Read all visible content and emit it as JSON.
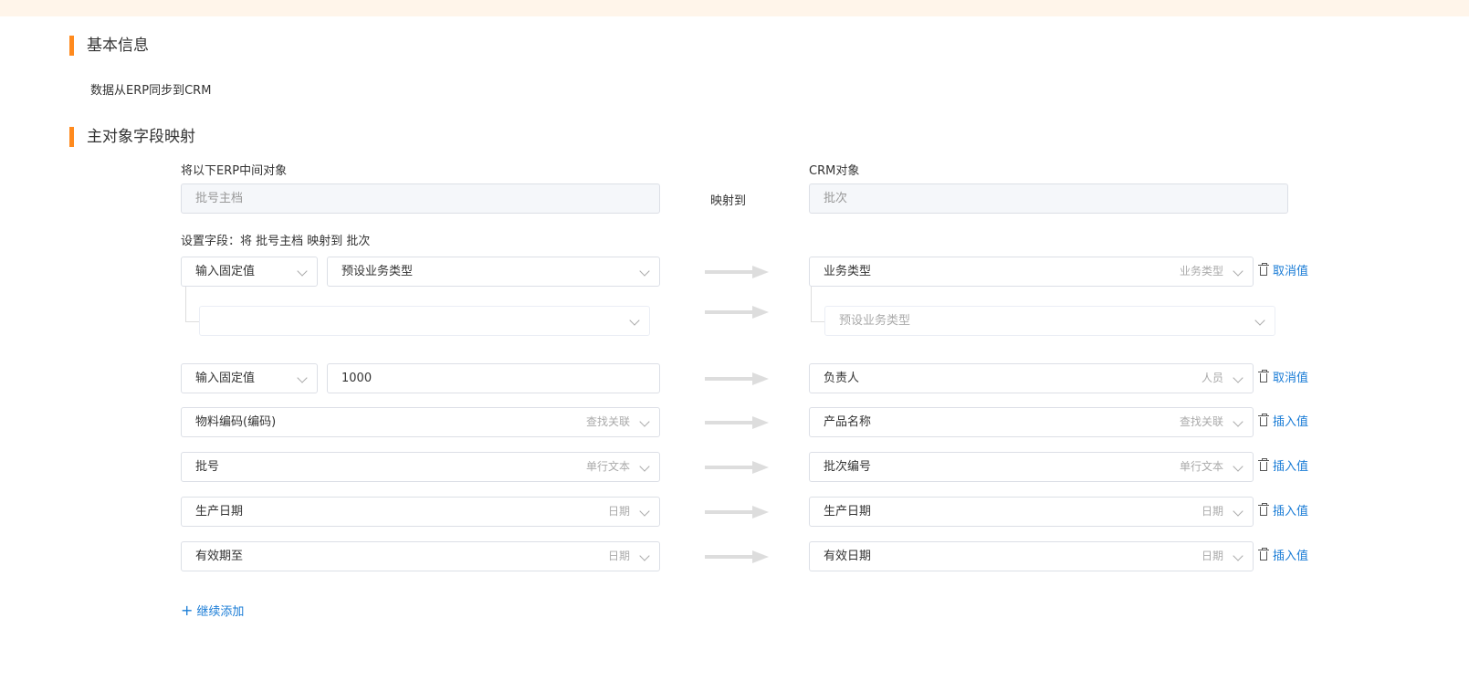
{
  "basic_section": {
    "title": "基本信息",
    "direction_text": "数据从ERP同步到CRM"
  },
  "mapping_section": {
    "title": "主对象字段映射",
    "erp_label": "将以下ERP中间对象",
    "crm_label": "CRM对象",
    "erp_object": "批号主档",
    "maps_to": "映射到",
    "crm_object": "批次",
    "fields_label": "设置字段：将 批号主档 映射到 批次"
  },
  "rows": [
    {
      "source_mode": "输入固定值",
      "source_value": "预设业务类型",
      "target_field": "业务类型",
      "target_type": "业务类型",
      "action": "取消值",
      "sub_source_value": "",
      "sub_target_value": "预设业务类型"
    },
    {
      "source_mode": "输入固定值",
      "source_value": "1000",
      "target_field": "负责人",
      "target_type": "人员",
      "action": "取消值"
    },
    {
      "source_field": "物料编码(编码)",
      "source_type": "查找关联",
      "target_field": "产品名称",
      "target_type": "查找关联",
      "action": "插入值"
    },
    {
      "source_field": "批号",
      "source_type": "单行文本",
      "target_field": "批次编号",
      "target_type": "单行文本",
      "action": "插入值"
    },
    {
      "source_field": "生产日期",
      "source_type": "日期",
      "target_field": "生产日期",
      "target_type": "日期",
      "action": "插入值"
    },
    {
      "source_field": "有效期至",
      "source_type": "日期",
      "target_field": "有效日期",
      "target_type": "日期",
      "action": "插入值"
    }
  ],
  "add_more_label": "继续添加",
  "colors": {
    "accent": "#ff8a1e",
    "link": "#1a7cd6",
    "topbar": "#fff5ea"
  }
}
